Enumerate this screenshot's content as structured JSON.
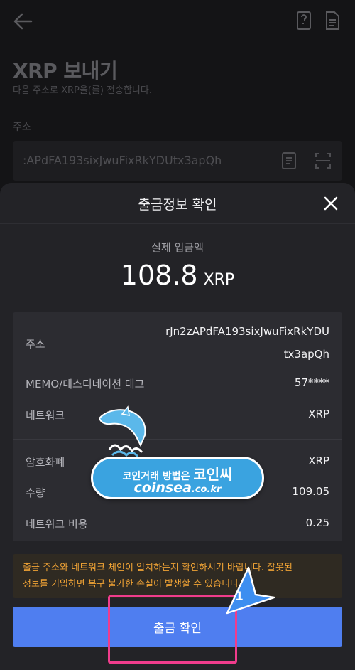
{
  "background": {
    "title": "XRP 보내기",
    "subtitle": "다음 주소로 XRP을(를) 전송합니다.",
    "address_label": "주소",
    "address_value": ":APdFA193sixJwuFixRkYDUtx3apQh",
    "icons": [
      "back-arrow-icon",
      "address-book-icon",
      "document-icon",
      "contacts-icon",
      "scan-icon"
    ]
  },
  "sheet": {
    "title": "출금정보 확인",
    "amount_label": "실제 입금액",
    "amount_value": "108.8",
    "amount_unit": "XRP",
    "rows": [
      {
        "label": "주소",
        "value_line1": "rJn2zAPdFA193sixJwuFixRkYDU",
        "value_line2": "tx3apQh"
      },
      {
        "label": "MEMO/데스티네이션 태그",
        "value": "57****"
      },
      {
        "label": "네트워크",
        "value": "XRP"
      },
      {
        "label": "암호화폐",
        "value": "XRP"
      },
      {
        "label": "수량",
        "value": "109.05"
      },
      {
        "label": "네트워크 비용",
        "value": "0.25"
      }
    ],
    "warning_line1": "출금 주소와 네트워크 체인이 일치하는지 확인하시기 바랍니다. 잘못된",
    "warning_line2": "정보를 기입하면 복구 불가한 손실이 발생할 수 있습니다",
    "confirm_label": "출금 확인"
  },
  "watermark": {
    "line1_prefix": "코인거래 방법은",
    "line1_brand": "코인씨",
    "line2_domain": "coinsea",
    "line2_tld": ".co.kr"
  },
  "annotation": {
    "step_number": "1"
  },
  "colors": {
    "sheet_bg": "#232327",
    "card_bg": "#2c2c31",
    "accent_button": "#4f7ef0",
    "warning_text": "#f0a335",
    "highlight": "#f03c8c"
  }
}
